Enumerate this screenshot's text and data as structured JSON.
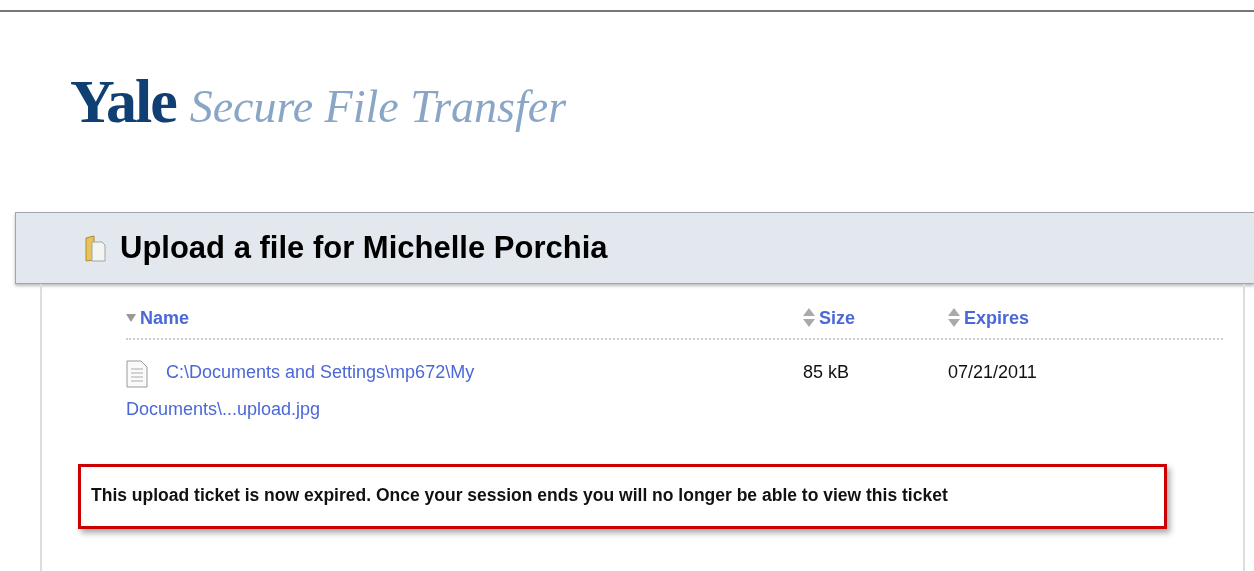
{
  "logo": {
    "brand": "Yale",
    "product": "Secure File Transfer"
  },
  "panel": {
    "title": "Upload a file for Michelle Porchia"
  },
  "table": {
    "columns": [
      {
        "label": "Name",
        "sorted": true
      },
      {
        "label": "Size",
        "sorted": false
      },
      {
        "label": "Expires",
        "sorted": false
      }
    ],
    "rows": [
      {
        "name": "C:\\Documents and Settings\\mp672\\My Documents\\...upload.jpg",
        "size": "85 kB",
        "expires": "07/21/2011"
      }
    ]
  },
  "notice": "This upload ticket is now expired. Once your session ends you will no longer be able to view this ticket"
}
